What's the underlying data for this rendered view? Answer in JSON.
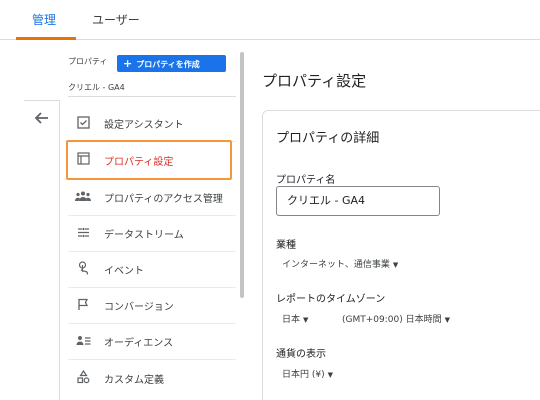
{
  "tabs": {
    "admin": "管理",
    "user": "ユーザー"
  },
  "property": {
    "label": "プロパティ",
    "create_button": "プロパティを作成",
    "name": "クリエル - GA4"
  },
  "sidebar": {
    "items": [
      {
        "label": "設定アシスタント",
        "icon": "checklist-icon"
      },
      {
        "label": "プロパティ設定",
        "icon": "property-settings-icon"
      },
      {
        "label": "プロパティのアクセス管理",
        "icon": "people-icon"
      },
      {
        "label": "データストリーム",
        "icon": "data-stream-icon"
      },
      {
        "label": "イベント",
        "icon": "touch-icon"
      },
      {
        "label": "コンバージョン",
        "icon": "flag-icon"
      },
      {
        "label": "オーディエンス",
        "icon": "audience-icon"
      },
      {
        "label": "カスタム定義",
        "icon": "custom-definitions-icon"
      }
    ]
  },
  "main": {
    "title": "プロパティ設定",
    "card_title": "プロパティの詳細",
    "property_name_label": "プロパティ名",
    "property_name_value": "クリエル - GA4",
    "industry_label": "業種",
    "industry_value": "インターネット、通信事業",
    "timezone_label": "レポートのタイムゾーン",
    "timezone_country": "日本",
    "timezone_value": "(GMT+09:00) 日本時間",
    "currency_label": "通貨の表示",
    "currency_value": "日本円 (¥)"
  },
  "colors": {
    "accent": "#1a73e8",
    "highlight": "#f4973b",
    "selected_text": "#d93025"
  }
}
